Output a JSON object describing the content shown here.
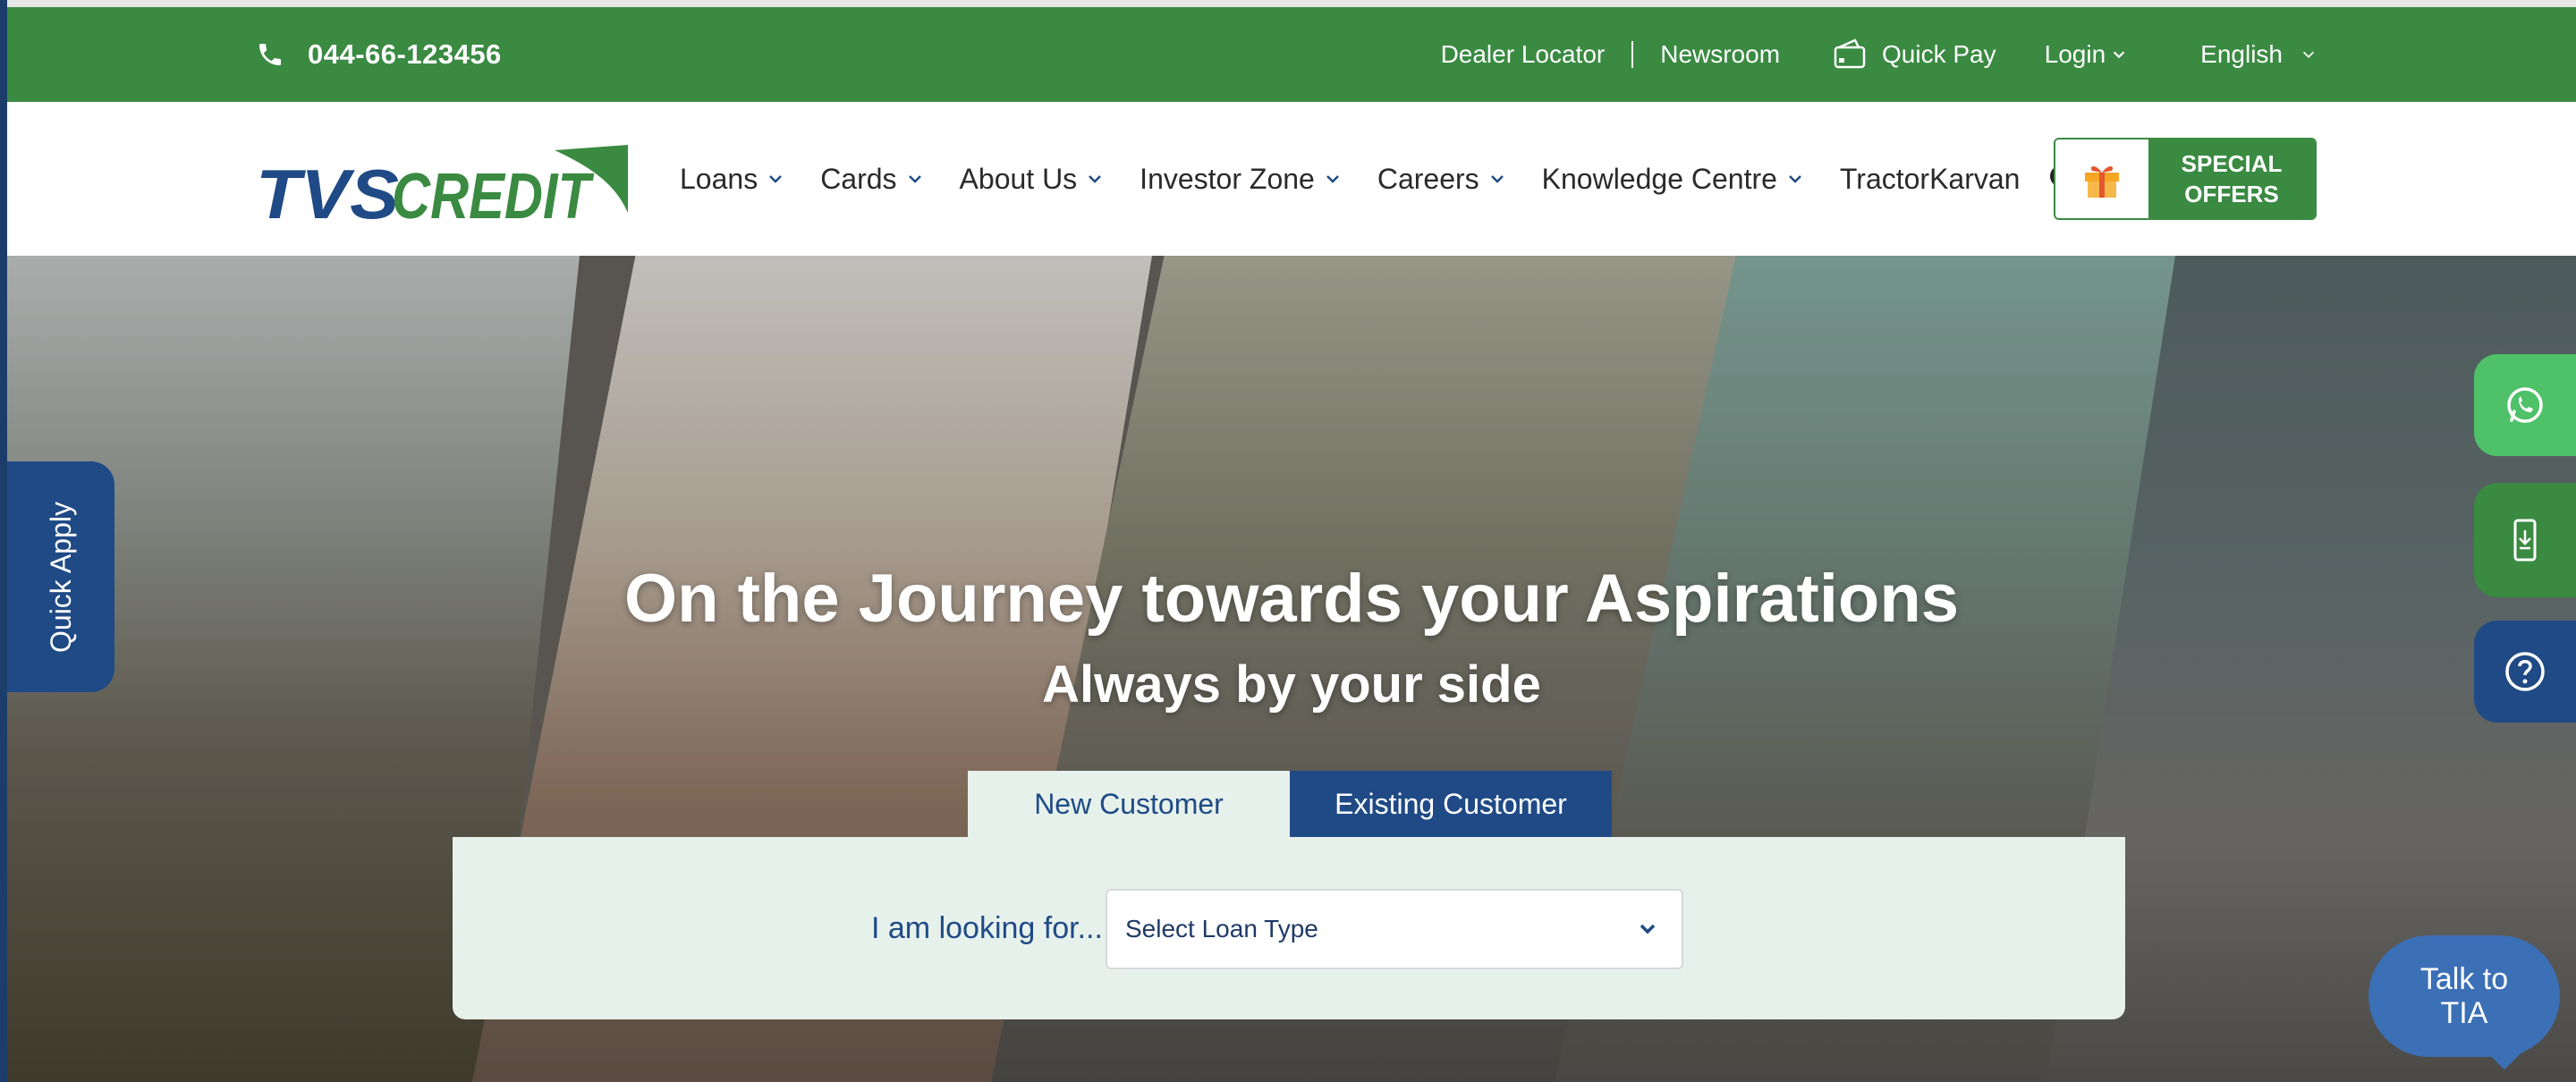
{
  "topbar": {
    "phone": "044-66-123456",
    "dealer_locator": "Dealer Locator",
    "newsroom": "Newsroom",
    "quick_pay": "Quick Pay",
    "login": "Login",
    "language": "English"
  },
  "nav": {
    "logo_text": "TVSCREDIT",
    "items": [
      {
        "label": "Loans"
      },
      {
        "label": "Cards"
      },
      {
        "label": "About Us"
      },
      {
        "label": "Investor Zone"
      },
      {
        "label": "Careers"
      },
      {
        "label": "Knowledge Centre"
      },
      {
        "label": "TractorKarvan"
      }
    ],
    "special_offers_line1": "SPECIAL",
    "special_offers_line2": "OFFERS"
  },
  "hero": {
    "title": "On the Journey towards your Aspirations",
    "subtitle": "Always by your side",
    "tabs": [
      {
        "label": "New Customer"
      },
      {
        "label": "Existing Customer"
      }
    ],
    "form_label": "I am looking for...",
    "select_placeholder": "Select Loan Type"
  },
  "side": {
    "quick_apply": "Quick Apply",
    "tia_line1": "Talk to",
    "tia_line2": "TIA"
  },
  "colors": {
    "brand_green": "#3a8a42",
    "brand_blue": "#1f4a85",
    "whatsapp_green": "#4fc169",
    "panel_bg": "#e6f1ec"
  }
}
